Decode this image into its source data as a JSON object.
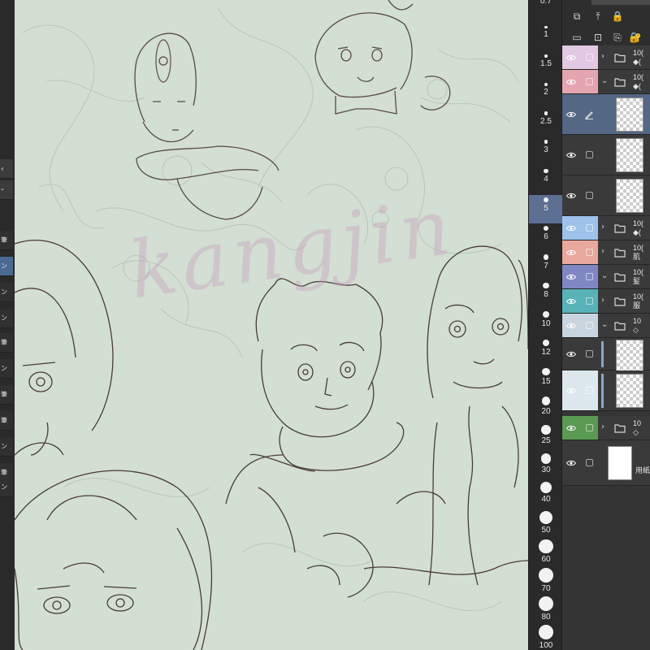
{
  "left_panel": {
    "items": [
      {
        "label": "ｨ",
        "style": "plain"
      },
      {
        "label": "ｰ",
        "style": "plain"
      },
      {
        "label": "筆",
        "style": "dark"
      },
      {
        "label": "ン",
        "style": "active"
      },
      {
        "label": "ン",
        "style": "dark"
      },
      {
        "label": "ン",
        "style": "dark"
      },
      {
        "label": "筆",
        "style": "dark"
      },
      {
        "label": "ン",
        "style": "dark"
      },
      {
        "label": "筆",
        "style": "dark"
      },
      {
        "label": "筆",
        "style": "dark"
      },
      {
        "label": "ン",
        "style": "dark"
      },
      {
        "label": "筆",
        "style": "dark"
      },
      {
        "label": "ン",
        "style": "dark"
      }
    ]
  },
  "canvas": {
    "watermark": "kangjin",
    "background": "#d2dfd2"
  },
  "brush_sizes": {
    "selected": "5",
    "items": [
      "0.7",
      "1",
      "1.5",
      "2",
      "2.5",
      "3",
      "4",
      "5",
      "6",
      "7",
      "8",
      "10",
      "12",
      "15",
      "20",
      "25",
      "30",
      "40",
      "50",
      "60",
      "70",
      "80",
      "100"
    ]
  },
  "layer_toolbar": {
    "icons": [
      "copy-layer-icon",
      "new-raster-layer-icon",
      "lock-icon",
      "new-folder-icon",
      "new-vector-layer-icon",
      "clip-icon",
      "lock-alpha-icon"
    ]
  },
  "layers": [
    {
      "eye_color": "#e2c8e2",
      "kind": "folder",
      "expanded": false,
      "name_lines": [
        "10(",
        "◆("
      ]
    },
    {
      "eye_color": "#e4a5b0",
      "kind": "folder",
      "expanded": true,
      "name_lines": [
        "10(",
        "◆("
      ]
    },
    {
      "eye_color": "#546784",
      "kind": "raster",
      "selected": true,
      "pen": true,
      "name_lines": [
        ""
      ]
    },
    {
      "eye_color": "#3a3a3a",
      "kind": "raster",
      "name_lines": [
        ""
      ]
    },
    {
      "eye_color": "#3a3a3a",
      "kind": "raster",
      "name_lines": [
        ""
      ]
    },
    {
      "eye_color": "#9ec2ea",
      "kind": "folder",
      "expanded": false,
      "name_lines": [
        "10(",
        "◆("
      ]
    },
    {
      "eye_color": "#e8a89e",
      "kind": "folder",
      "expanded": false,
      "name_lines": [
        "10(",
        "肌"
      ]
    },
    {
      "eye_color": "#8088c4",
      "kind": "folder",
      "expanded": true,
      "name_lines": [
        "10(",
        "髪"
      ]
    },
    {
      "eye_color": "#58b3b8",
      "kind": "folder",
      "expanded": false,
      "name_lines": [
        "10(",
        "服"
      ]
    },
    {
      "eye_color": "#c8d4de",
      "kind": "folder",
      "expanded": true,
      "name_lines": [
        "10",
        "◇"
      ]
    },
    {
      "eye_color": "#3a3a3a",
      "kind": "raster",
      "name_lines": [
        ""
      ]
    },
    {
      "eye_color": "#dce8ee",
      "kind": "raster",
      "name_lines": [
        ""
      ]
    },
    {
      "eye_color": "#5a9a52",
      "kind": "folder",
      "expanded": false,
      "name_lines": [
        "10",
        "◇"
      ]
    },
    {
      "eye_color": "#3a3a3a",
      "kind": "paper",
      "name_lines": [
        "用紙"
      ]
    }
  ]
}
